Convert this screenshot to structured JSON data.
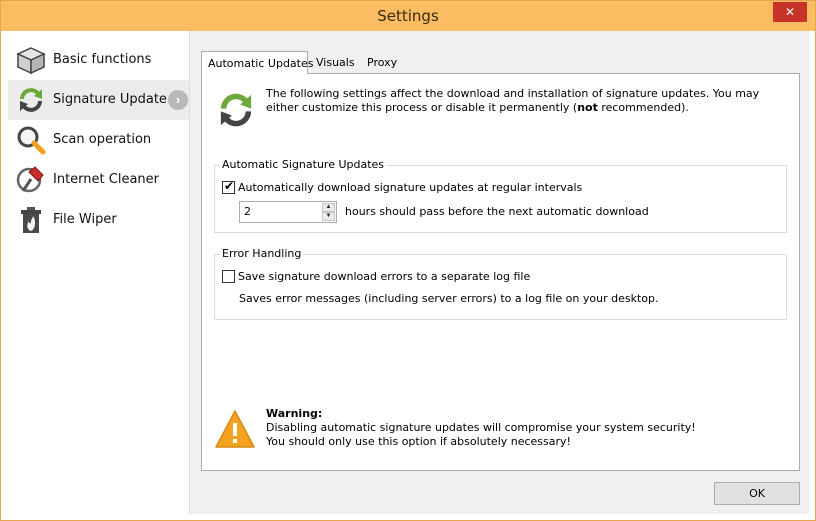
{
  "window": {
    "title": "Settings",
    "close_glyph": "✕"
  },
  "sidebar": {
    "items": [
      {
        "label": "Basic functions",
        "icon": "box-icon"
      },
      {
        "label": "Signature Update",
        "icon": "refresh-icon"
      },
      {
        "label": "Scan operation",
        "icon": "magnifier-icon"
      },
      {
        "label": "Internet Cleaner",
        "icon": "broom-icon"
      },
      {
        "label": "File Wiper",
        "icon": "trash-fire-icon"
      }
    ],
    "active_index": 1,
    "arrow_glyph": "›"
  },
  "tabs": [
    {
      "label": "Automatic Updates"
    },
    {
      "label": "Visuals"
    },
    {
      "label": "Proxy"
    }
  ],
  "intro": {
    "text_before": "The following settings affect the download and installation of signature updates. You may either customize this process or disable it permanently (",
    "text_bold": "not",
    "text_after": " recommended)."
  },
  "auto_group": {
    "title": "Automatic Signature Updates",
    "checkbox_label": "Automatically download signature updates at regular intervals",
    "checked": true,
    "check_glyph": "✔",
    "hours_value": "2",
    "spin_up": "▲",
    "spin_down": "▼",
    "hours_label": "hours should pass before the next automatic download"
  },
  "error_group": {
    "title": "Error Handling",
    "checkbox_label": "Save signature download errors to a separate log file",
    "checked": false,
    "description": "Saves error messages (including server errors) to a log file on your desktop."
  },
  "warning": {
    "title": "Warning:",
    "line1": "Disabling automatic signature updates will compromise your system security!",
    "line2": "You should only use this option if absolutely necessary!"
  },
  "buttons": {
    "ok": "OK"
  },
  "colors": {
    "title_bar": "#fbbc62",
    "close": "#c7352a",
    "accent_green": "#6da93a",
    "warning": "#f3a320"
  }
}
